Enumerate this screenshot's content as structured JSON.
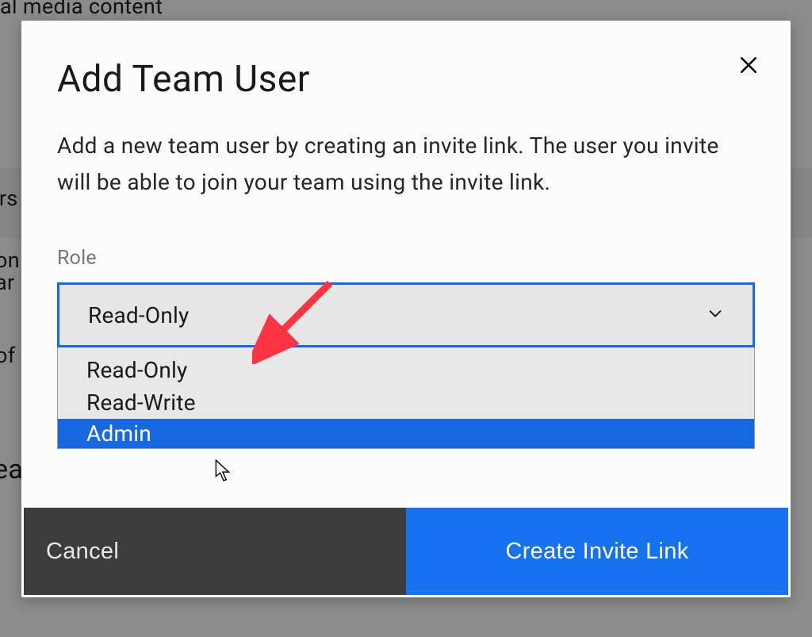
{
  "backgroundSnippets": {
    "top": "al media content",
    "row1a": "irs",
    "row2a": "on",
    "row2b": "ar",
    "row3a": "of",
    "row4a": "ea"
  },
  "modal": {
    "title": "Add Team User",
    "description": "Add a new team user by creating an invite link. The user you invite will be able to join your team using the invite link.",
    "roleLabel": "Role",
    "roleSelected": "Read-Only",
    "roleOptions": [
      {
        "label": "Read-Only",
        "highlighted": false
      },
      {
        "label": "Read-Write",
        "highlighted": false
      },
      {
        "label": "Admin",
        "highlighted": true
      }
    ],
    "buttons": {
      "cancel": "Cancel",
      "primary": "Create Invite Link"
    }
  }
}
